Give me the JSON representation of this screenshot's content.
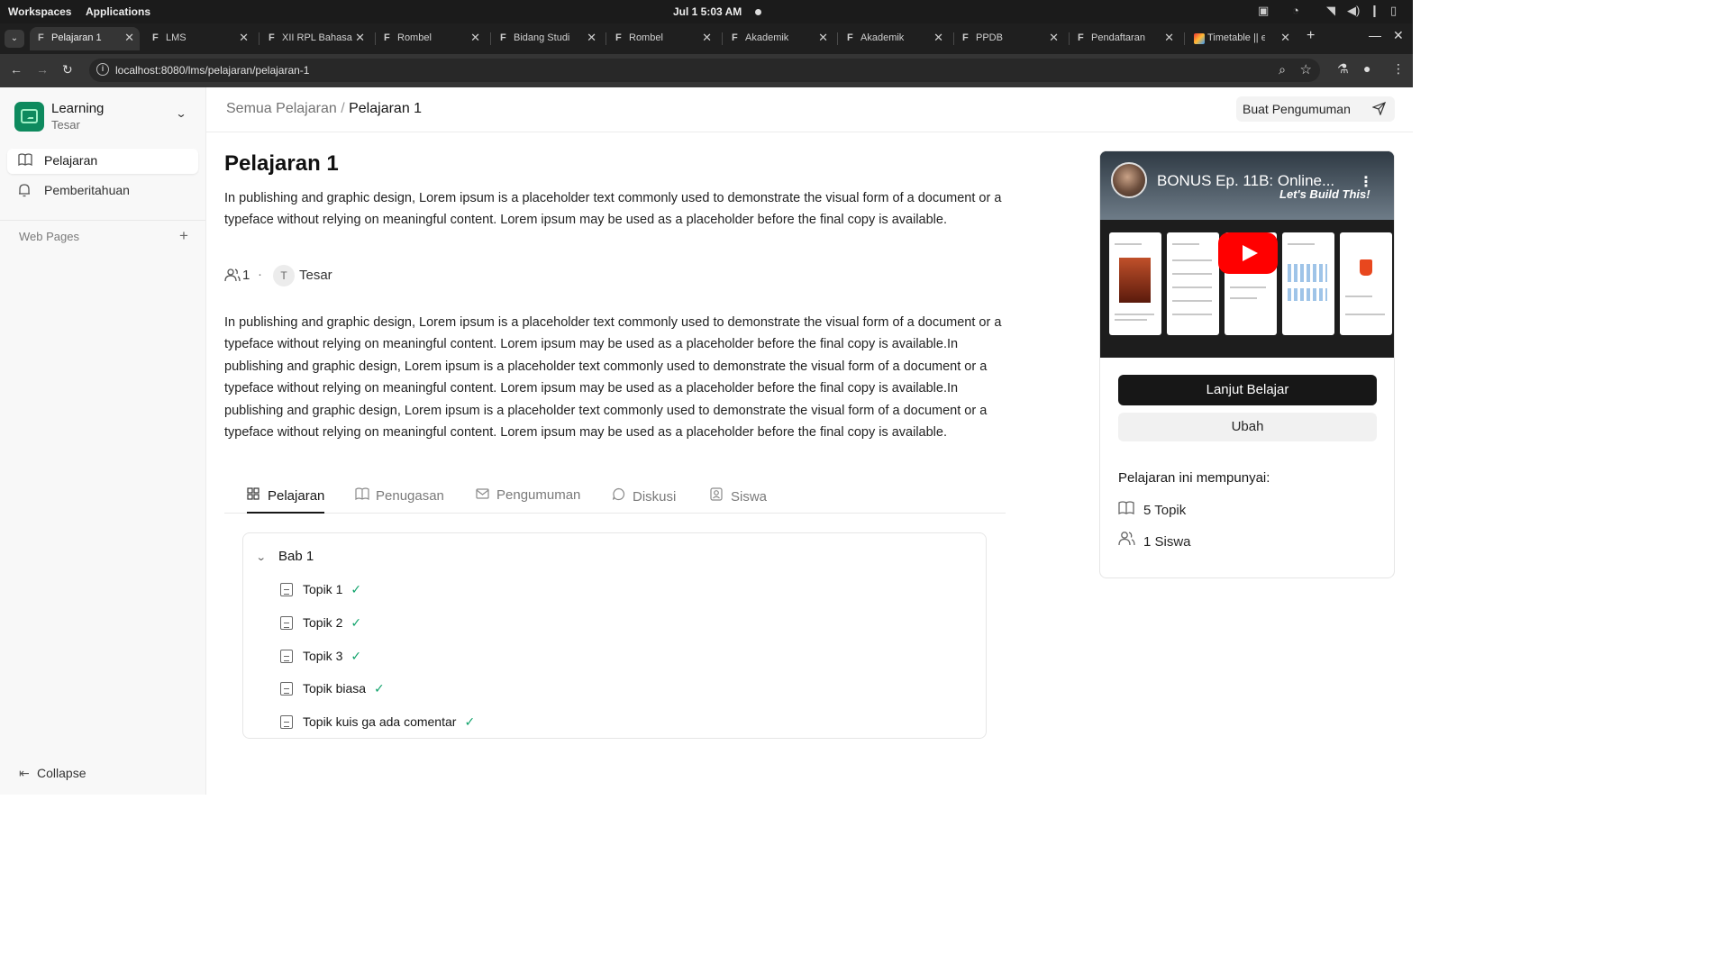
{
  "os": {
    "workspaces": "Workspaces",
    "applications": "Applications",
    "clock": "Jul 1  5:03 AM"
  },
  "browser": {
    "tabs": [
      {
        "title": "Pelajaran 1"
      },
      {
        "title": "LMS"
      },
      {
        "title": "XII RPL Bahasa"
      },
      {
        "title": "Rombel"
      },
      {
        "title": "Bidang Studi"
      },
      {
        "title": "Rombel"
      },
      {
        "title": "Akademik"
      },
      {
        "title": "Akademik"
      },
      {
        "title": "PPDB"
      },
      {
        "title": "Pendaftaran"
      },
      {
        "title": "Timetable || e"
      }
    ],
    "url": "localhost:8080/lms/pelajaran/pelajaran-1"
  },
  "sidebar": {
    "brand_title": "Learning",
    "brand_sub": "Tesar",
    "items": [
      {
        "label": "Pelajaran",
        "icon": "book-icon"
      },
      {
        "label": "Pemberitahuan",
        "icon": "bell-icon"
      }
    ],
    "web_pages": "Web Pages",
    "collapse": "Collapse"
  },
  "header": {
    "breadcrumb_root": "Semua Pelajaran",
    "breadcrumb_sep": "/",
    "breadcrumb_current": "Pelajaran 1",
    "announce_label": "Buat Pengumuman"
  },
  "course": {
    "title": "Pelajaran 1",
    "short_desc": "In publishing and graphic design, Lorem ipsum is a placeholder text commonly used to demonstrate the visual form of a document or a typeface without relying on meaningful content. Lorem ipsum may be used as a placeholder before the final copy is available.",
    "student_count": "1",
    "instructor_initial": "T",
    "instructor": "Tesar",
    "long_desc": "In publishing and graphic design, Lorem ipsum is a placeholder text commonly used to demonstrate the visual form of a document or a typeface without relying on meaningful content. Lorem ipsum may be used as a placeholder before the final copy is available.In publishing and graphic design, Lorem ipsum is a placeholder text commonly used to demonstrate the visual form of a document or a typeface without relying on meaningful content. Lorem ipsum may be used as a placeholder before the final copy is available.In publishing and graphic design, Lorem ipsum is a placeholder text commonly used to demonstrate the visual form of a document or a typeface without relying on meaningful content. Lorem ipsum may be used as a placeholder before the final copy is available."
  },
  "tabs": [
    {
      "label": "Pelajaran",
      "active": true
    },
    {
      "label": "Penugasan"
    },
    {
      "label": "Pengumuman"
    },
    {
      "label": "Diskusi"
    },
    {
      "label": "Siswa"
    }
  ],
  "outline": {
    "chapter": "Bab 1",
    "topics": [
      {
        "label": "Topik 1",
        "done": true
      },
      {
        "label": "Topik 2",
        "done": true
      },
      {
        "label": "Topik 3",
        "done": true
      },
      {
        "label": "Topik biasa",
        "done": true
      },
      {
        "label": "Topik kuis ga ada comentar",
        "done": true
      }
    ]
  },
  "card": {
    "video_title": "BONUS Ep. 11B: Online...",
    "video_subtitle": "Let's Build This!",
    "continue_label": "Lanjut Belajar",
    "edit_label": "Ubah",
    "has_title": "Pelajaran ini mempunyai:",
    "topics_count": "5 Topik",
    "students_count": "1 Siswa"
  },
  "colors": {
    "brand": "#0e8a5e",
    "check": "#10a36b",
    "primary_button": "#171717"
  }
}
